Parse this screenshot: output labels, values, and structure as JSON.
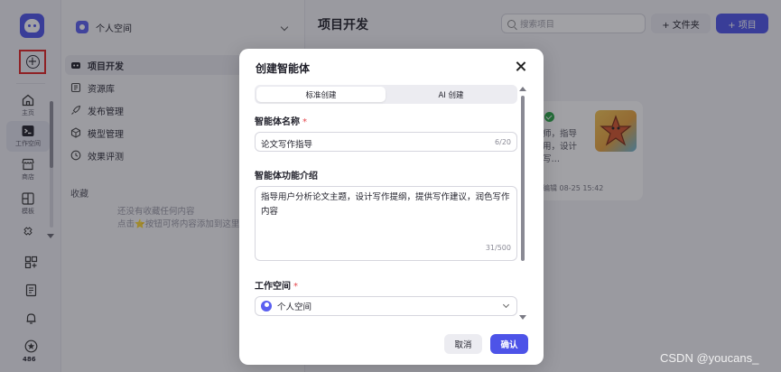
{
  "rail": {
    "items": [
      {
        "label": "主页",
        "icon": "home-icon"
      },
      {
        "label": "工作空间",
        "icon": "terminal-icon"
      },
      {
        "label": "商店",
        "icon": "store-icon"
      },
      {
        "label": "模板",
        "icon": "template-icon"
      },
      {
        "label": "",
        "icon": "plugin-icon"
      }
    ],
    "bottom_icons": [
      "apps-icon",
      "doc-icon",
      "bell-icon",
      "star-badge-icon"
    ],
    "badge_count": "486"
  },
  "nav": {
    "workspace": "个人空间",
    "items": [
      {
        "label": "项目开发",
        "icon": "bot-icon",
        "active": true
      },
      {
        "label": "资源库",
        "icon": "library-icon"
      },
      {
        "label": "发布管理",
        "icon": "rocket-icon"
      },
      {
        "label": "模型管理",
        "icon": "model-icon"
      },
      {
        "label": "效果评测",
        "icon": "evaluation-icon"
      }
    ],
    "favorites_title": "收藏",
    "favorites_empty_line1": "还没有收藏任何内容",
    "favorites_empty_line2": "点击⭐按钮可将内容添加到这里"
  },
  "main": {
    "title": "项目开发",
    "search_placeholder": "搜索项目",
    "folder_button": "+ 文件夹",
    "project_button": "+ 项目",
    "card": {
      "desc": "师，指导用，设计写…",
      "meta": "编辑 08-25 15:42"
    }
  },
  "dialog": {
    "title": "创建智能体",
    "tabs": [
      "标准创建",
      "AI 创建"
    ],
    "name_label": "智能体名称",
    "name_value": "论文写作指导",
    "name_count": "6/20",
    "intro_label": "智能体功能介绍",
    "intro_value": "指导用户分析论文主题，设计写作提纲，提供写作建议，润色写作内容",
    "intro_count": "31/500",
    "workspace_label": "工作空间",
    "workspace_value": "个人空间",
    "required_mark": "*",
    "cancel": "取消",
    "confirm": "确认"
  },
  "watermark": "CSDN @youcans_",
  "colors": {
    "accent": "#4d53e8",
    "required": "#e5484d",
    "highlight_box": "#e02424"
  }
}
